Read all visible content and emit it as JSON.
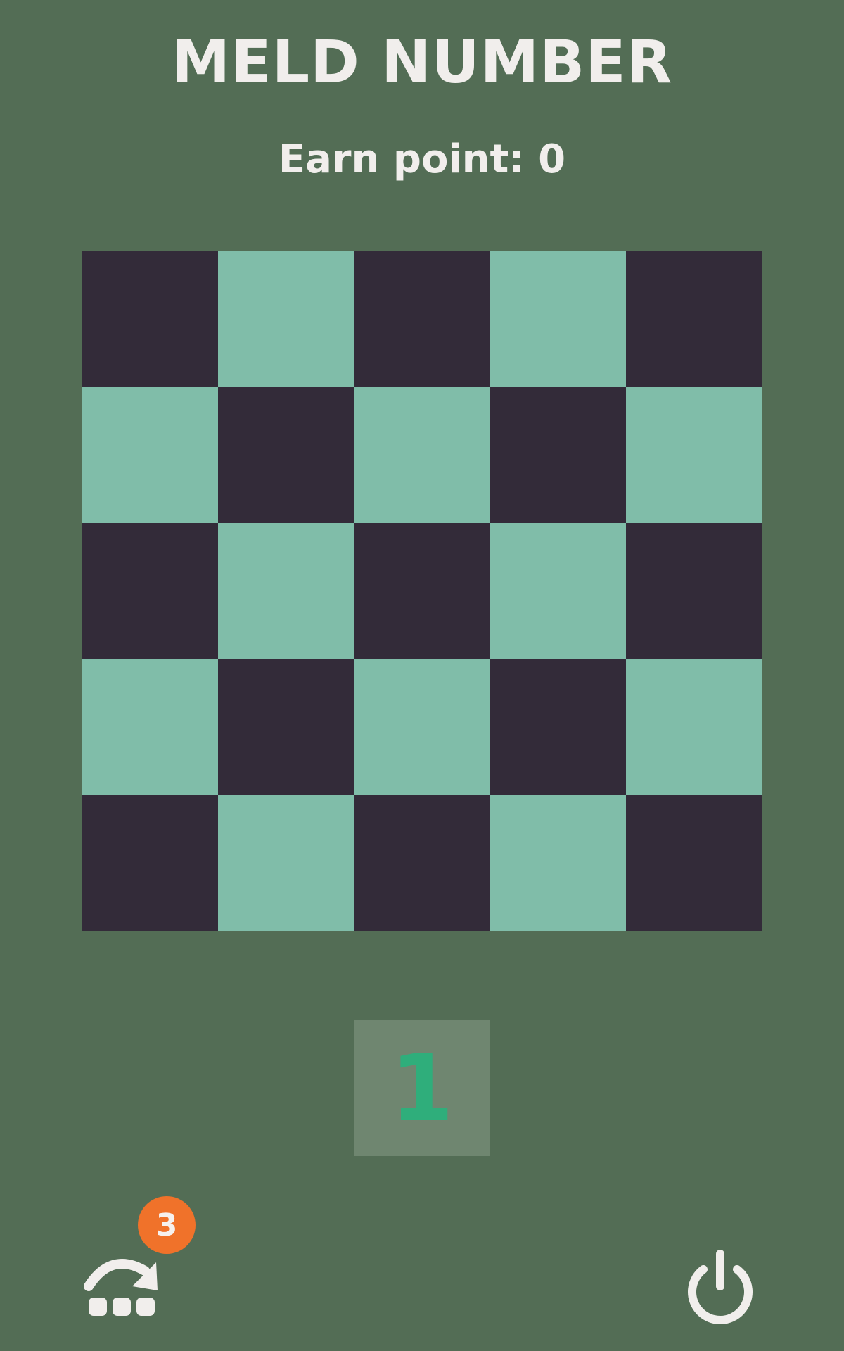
{
  "header": {
    "title": "MELD NUMBER",
    "score_text": "Earn point: 0"
  },
  "board": {
    "rows": 5,
    "cols": 5,
    "colors": {
      "dark": "#332b39",
      "light": "#80bda9"
    },
    "cells": [
      [
        "dark",
        "light",
        "dark",
        "light",
        "dark"
      ],
      [
        "light",
        "dark",
        "light",
        "dark",
        "light"
      ],
      [
        "dark",
        "light",
        "dark",
        "light",
        "dark"
      ],
      [
        "light",
        "dark",
        "light",
        "dark",
        "light"
      ],
      [
        "dark",
        "light",
        "dark",
        "light",
        "dark"
      ]
    ]
  },
  "next_tile": {
    "value": "1",
    "color": "#2fae7b"
  },
  "controls": {
    "skip": {
      "icon": "skip-tile-icon",
      "badge_count": "3",
      "badge_color": "#f0722a"
    },
    "power": {
      "icon": "power-icon"
    }
  },
  "colors": {
    "background": "#536d55",
    "text": "#f1eeec"
  }
}
